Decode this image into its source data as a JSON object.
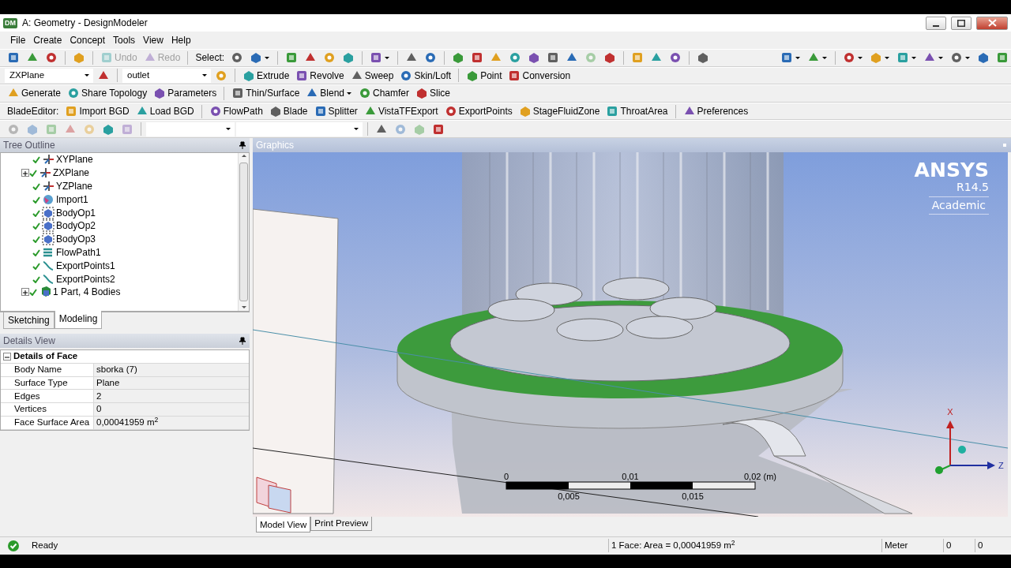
{
  "window": {
    "badge": "DM",
    "title": "A: Geometry - DesignModeler"
  },
  "menu": [
    "File",
    "Create",
    "Concept",
    "Tools",
    "View",
    "Help"
  ],
  "toolbars": [
    [
      {
        "kind": "icon",
        "disabled": false
      },
      {
        "kind": "icon",
        "disabled": false
      },
      {
        "kind": "icon",
        "disabled": false
      },
      {
        "kind": "sep"
      },
      {
        "kind": "icon",
        "disabled": false
      },
      {
        "kind": "sep"
      },
      {
        "kind": "button",
        "label": "Undo",
        "disabled": true
      },
      {
        "kind": "button",
        "label": "Redo",
        "disabled": true
      },
      {
        "kind": "sep"
      },
      {
        "kind": "label",
        "label": "Select:"
      },
      {
        "kind": "icon",
        "disabled": false
      },
      {
        "kind": "icon-menu",
        "disabled": false
      },
      {
        "kind": "sep"
      },
      {
        "kind": "icon",
        "disabled": false
      },
      {
        "kind": "icon",
        "disabled": false
      },
      {
        "kind": "icon",
        "disabled": false
      },
      {
        "kind": "icon",
        "disabled": false
      },
      {
        "kind": "sep"
      },
      {
        "kind": "icon-menu",
        "disabled": false
      },
      {
        "kind": "sep"
      },
      {
        "kind": "icon",
        "disabled": false
      },
      {
        "kind": "icon",
        "disabled": false
      },
      {
        "kind": "sep"
      },
      {
        "kind": "icon",
        "disabled": false
      },
      {
        "kind": "icon",
        "disabled": false
      },
      {
        "kind": "icon",
        "disabled": false
      },
      {
        "kind": "icon",
        "disabled": false
      },
      {
        "kind": "icon",
        "disabled": false
      },
      {
        "kind": "icon",
        "disabled": false
      },
      {
        "kind": "icon",
        "disabled": false
      },
      {
        "kind": "icon",
        "disabled": true
      },
      {
        "kind": "icon",
        "disabled": false
      },
      {
        "kind": "sep"
      },
      {
        "kind": "icon",
        "disabled": false
      },
      {
        "kind": "icon",
        "disabled": false
      },
      {
        "kind": "icon",
        "disabled": false
      },
      {
        "kind": "sep"
      },
      {
        "kind": "icon",
        "disabled": false
      },
      {
        "kind": "spacer"
      },
      {
        "kind": "icon-menu",
        "disabled": false
      },
      {
        "kind": "icon-menu",
        "disabled": false
      },
      {
        "kind": "sep"
      },
      {
        "kind": "icon-menu",
        "disabled": false
      },
      {
        "kind": "icon-menu",
        "disabled": false
      },
      {
        "kind": "icon-menu",
        "disabled": false
      },
      {
        "kind": "icon-menu",
        "disabled": false
      },
      {
        "kind": "icon-menu",
        "disabled": false
      },
      {
        "kind": "icon",
        "disabled": false
      },
      {
        "kind": "icon",
        "disabled": false
      }
    ],
    [
      {
        "kind": "dropdown",
        "label": "ZXPlane"
      },
      {
        "kind": "icon",
        "disabled": false
      },
      {
        "kind": "sep"
      },
      {
        "kind": "dropdown",
        "label": "outlet"
      },
      {
        "kind": "icon",
        "disabled": false
      },
      {
        "kind": "sep"
      },
      {
        "kind": "button",
        "label": "Extrude",
        "disabled": false
      },
      {
        "kind": "button",
        "label": "Revolve",
        "disabled": false
      },
      {
        "kind": "button",
        "label": "Sweep",
        "disabled": false
      },
      {
        "kind": "button",
        "label": "Skin/Loft",
        "disabled": false
      },
      {
        "kind": "sep"
      },
      {
        "kind": "button",
        "label": "Point",
        "disabled": false
      },
      {
        "kind": "button",
        "label": "Conversion",
        "disabled": false
      }
    ],
    [
      {
        "kind": "button",
        "label": "Generate",
        "disabled": false
      },
      {
        "kind": "button",
        "label": "Share Topology",
        "disabled": false
      },
      {
        "kind": "button",
        "label": "Parameters",
        "disabled": false
      },
      {
        "kind": "sep"
      },
      {
        "kind": "button",
        "label": "Thin/Surface",
        "disabled": false
      },
      {
        "kind": "menu-button",
        "label": "Blend",
        "disabled": false
      },
      {
        "kind": "button",
        "label": "Chamfer",
        "disabled": false
      },
      {
        "kind": "button",
        "label": "Slice",
        "disabled": false
      }
    ],
    [
      {
        "kind": "label",
        "label": "BladeEditor:"
      },
      {
        "kind": "button",
        "label": "Import BGD",
        "disabled": false
      },
      {
        "kind": "button",
        "label": "Load BGD",
        "disabled": false
      },
      {
        "kind": "sep"
      },
      {
        "kind": "button",
        "label": "FlowPath",
        "disabled": false
      },
      {
        "kind": "button",
        "label": "Blade",
        "disabled": false
      },
      {
        "kind": "button",
        "label": "Splitter",
        "disabled": false
      },
      {
        "kind": "button",
        "label": "VistaTFExport",
        "disabled": false
      },
      {
        "kind": "button",
        "label": "ExportPoints",
        "disabled": false
      },
      {
        "kind": "button",
        "label": "StageFluidZone",
        "disabled": false
      },
      {
        "kind": "button",
        "label": "ThroatArea",
        "disabled": false
      },
      {
        "kind": "sep"
      },
      {
        "kind": "button",
        "label": "Preferences",
        "disabled": false
      }
    ],
    [
      {
        "kind": "icon",
        "disabled": true
      },
      {
        "kind": "icon",
        "disabled": true
      },
      {
        "kind": "icon",
        "disabled": true
      },
      {
        "kind": "icon",
        "disabled": true
      },
      {
        "kind": "icon",
        "disabled": true
      },
      {
        "kind": "icon",
        "disabled": false
      },
      {
        "kind": "icon",
        "disabled": true
      },
      {
        "kind": "sep"
      },
      {
        "kind": "dropdown"
      },
      {
        "kind": "dropdown-wide"
      },
      {
        "kind": "sep"
      },
      {
        "kind": "icon",
        "disabled": false
      },
      {
        "kind": "icon",
        "disabled": true
      },
      {
        "kind": "icon",
        "disabled": true
      },
      {
        "kind": "icon",
        "disabled": false
      }
    ]
  ],
  "tree": {
    "title": "Tree Outline",
    "items": [
      {
        "label": "XYPlane"
      },
      {
        "label": "ZXPlane",
        "expanded": false
      },
      {
        "label": "YZPlane"
      },
      {
        "label": "Import1"
      },
      {
        "label": "BodyOp1"
      },
      {
        "label": "BodyOp2"
      },
      {
        "label": "BodyOp3"
      },
      {
        "label": "FlowPath1"
      },
      {
        "label": "ExportPoints1"
      },
      {
        "label": "ExportPoints2"
      },
      {
        "label": "1 Part, 4 Bodies",
        "expanded": false
      }
    ],
    "tabs": [
      {
        "label": "Sketching",
        "selected": false
      },
      {
        "label": "Modeling",
        "selected": true
      }
    ]
  },
  "details": {
    "title": "Details View",
    "group": "Details of Face",
    "expanded": true,
    "rows": [
      {
        "name": "Body Name",
        "value": "sborka (7)"
      },
      {
        "name": "Surface Type",
        "value": "Plane"
      },
      {
        "name": "Edges",
        "value": "2"
      },
      {
        "name": "Vertices",
        "value": "0"
      },
      {
        "name": "Face Surface Area",
        "value": "0,00041959 m$^{2}$"
      }
    ]
  },
  "graphics": {
    "title": "Graphics",
    "logo": {
      "name": "ANSYS",
      "version": "R14.5",
      "edition": "Academic"
    },
    "scale_bar": {
      "top_labels": [
        "0",
        "0,01",
        "0,02 (m)"
      ],
      "bottom_labels": [
        "0,005",
        "0,015"
      ]
    },
    "axis_labels": [
      "X",
      "Z"
    ],
    "tabs": [
      {
        "label": "Model View",
        "selected": true
      },
      {
        "label": "Print Preview",
        "selected": false
      }
    ]
  },
  "status_bar": {
    "message": "Ready",
    "selection": "1 Face: Area = 0,00041959 m$^{2}$",
    "unit": "Meter",
    "field_1": "0",
    "field_2": "0"
  }
}
